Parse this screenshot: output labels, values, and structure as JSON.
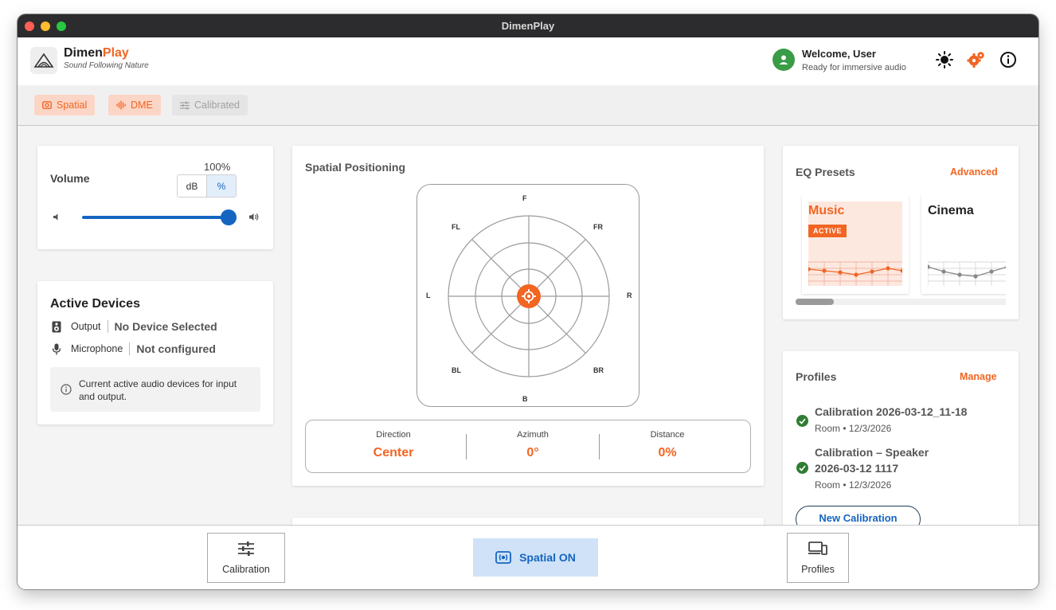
{
  "window": {
    "title": "DimenPlay"
  },
  "brand": {
    "name_part1": "Dimen",
    "name_part2": "Play",
    "tagline": "Sound Following Nature"
  },
  "user": {
    "welcome": "Welcome, User",
    "status": "Ready for immersive audio"
  },
  "header_icons": [
    "sun-icon",
    "gear-icon",
    "info-icon"
  ],
  "mode_chips": [
    {
      "label": "Spatial",
      "state": "active"
    },
    {
      "label": "DME",
      "state": "active"
    },
    {
      "label": "Calibrated",
      "state": "disabled"
    }
  ],
  "volume": {
    "title": "Volume",
    "value_display": "100%",
    "level_fraction": 1.0,
    "units": [
      "dB",
      "%"
    ],
    "selected_unit": "%"
  },
  "active_devices": {
    "title": "Active Devices",
    "output_label": "Output",
    "output_value": "No Device Selected",
    "mic_label": "Microphone",
    "mic_value": "Not configured",
    "info": "Current active audio devices for input and output."
  },
  "spatial": {
    "title": "Spatial Positioning",
    "directions": {
      "f": "F",
      "fl": "FL",
      "fr": "FR",
      "l": "L",
      "r": "R",
      "bl": "BL",
      "br": "BR",
      "b": "B"
    },
    "direction_label": "Direction",
    "direction_value": "Center",
    "azimuth_label": "Azimuth",
    "azimuth_value": "0°",
    "distance_label": "Distance",
    "distance_value": "0%"
  },
  "eq": {
    "title": "EQ Presets",
    "advanced_label": "Advanced",
    "presets": [
      {
        "name": "Music",
        "badge": "ACTIVE",
        "active": true
      },
      {
        "name": "Cinema",
        "active": false
      }
    ],
    "accent": "#f26522"
  },
  "profiles": {
    "title": "Profiles",
    "manage_label": "Manage",
    "items": [
      {
        "name": "Calibration 2026-03-12_11-18",
        "meta": "Room • 12/3/2026"
      },
      {
        "name_line1": "Calibration – Speaker",
        "name_line2": "2026-03-12 1117",
        "meta": "Room • 12/3/2026"
      }
    ],
    "new_button": "New Calibration"
  },
  "bottom_nav": {
    "calibration": "Calibration",
    "spatial_toggle": "Spatial ON",
    "profiles": "Profiles"
  }
}
